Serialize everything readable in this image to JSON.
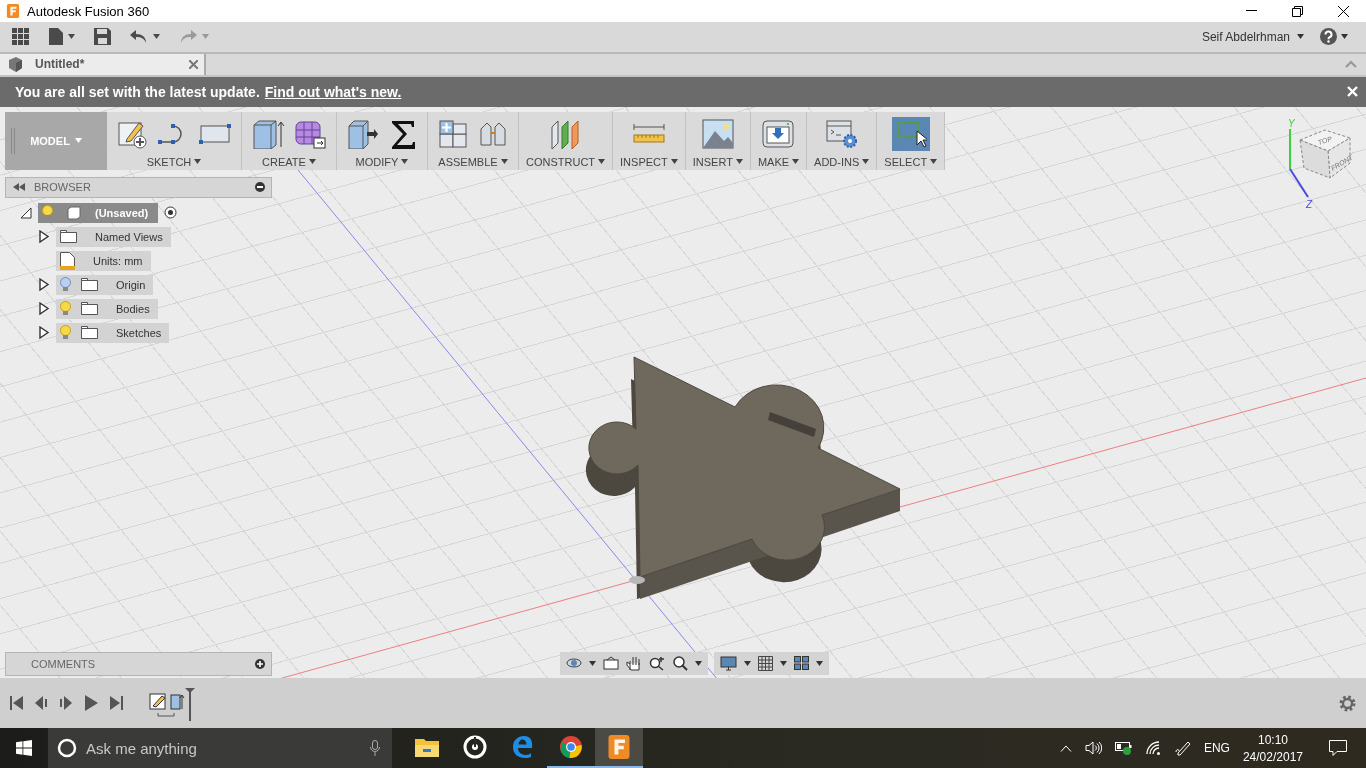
{
  "window": {
    "title": "Autodesk Fusion 360"
  },
  "quick_actions": [
    {
      "kind": "apps",
      "menu": false,
      "disabled": false
    },
    {
      "kind": "file",
      "menu": true,
      "disabled": false
    },
    {
      "kind": "save",
      "menu": false,
      "disabled": false
    },
    {
      "kind": "undo",
      "menu": true,
      "disabled": false
    },
    {
      "kind": "redo",
      "menu": true,
      "disabled": true
    }
  ],
  "user": {
    "name": "Seif Abdelrhman"
  },
  "tabs": [
    {
      "label": "Untitled*",
      "selected": true
    }
  ],
  "notification": {
    "text": "You are all set with the latest update.",
    "link": "Find out what's new."
  },
  "workspace": {
    "label": "MODEL"
  },
  "toolbar_groups": [
    {
      "kind": "sketch",
      "label": "SKETCH",
      "selected": false
    },
    {
      "kind": "create",
      "label": "CREATE",
      "selected": false
    },
    {
      "kind": "modify",
      "label": "MODIFY",
      "selected": false
    },
    {
      "kind": "assemble",
      "label": "ASSEMBLE",
      "selected": false
    },
    {
      "kind": "construct",
      "label": "CONSTRUCT",
      "selected": false
    },
    {
      "kind": "inspect",
      "label": "INSPECT",
      "selected": false
    },
    {
      "kind": "insert",
      "label": "INSERT",
      "selected": false
    },
    {
      "kind": "make",
      "label": "MAKE",
      "selected": false
    },
    {
      "kind": "addins",
      "label": "ADD-INS",
      "selected": false
    },
    {
      "kind": "select",
      "label": "SELECT",
      "selected": true
    }
  ],
  "browser": {
    "title": "BROWSER",
    "tree": [
      {
        "label": "(Unsaved)",
        "kind": "component",
        "visible": true,
        "expanded": true,
        "children": [
          {
            "label": "Named Views",
            "kind": "views",
            "expanded": false
          },
          {
            "label": "Units: mm",
            "kind": "units"
          },
          {
            "label": "Origin",
            "kind": "folder",
            "visible": false,
            "expanded": false
          },
          {
            "label": "Bodies",
            "kind": "folder",
            "visible": true,
            "expanded": false
          },
          {
            "label": "Sketches",
            "kind": "folder",
            "visible": true,
            "expanded": false
          }
        ]
      }
    ]
  },
  "view_cube": {
    "faces": [
      "TOP",
      "FRONT"
    ],
    "axes": [
      "Y",
      "Z"
    ]
  },
  "comments": {
    "title": "COMMENTS"
  },
  "taskbar": {
    "search_placeholder": "Ask me anything",
    "apps": [
      {
        "kind": "explorer",
        "running": false,
        "selected": false
      },
      {
        "kind": "music",
        "running": false,
        "selected": false
      },
      {
        "kind": "edge",
        "running": false,
        "selected": false
      },
      {
        "kind": "chrome",
        "running": true,
        "selected": false
      },
      {
        "kind": "fusion",
        "running": true,
        "selected": true
      }
    ],
    "language": "ENG",
    "time": "10:10",
    "date": "24/02/2017"
  }
}
